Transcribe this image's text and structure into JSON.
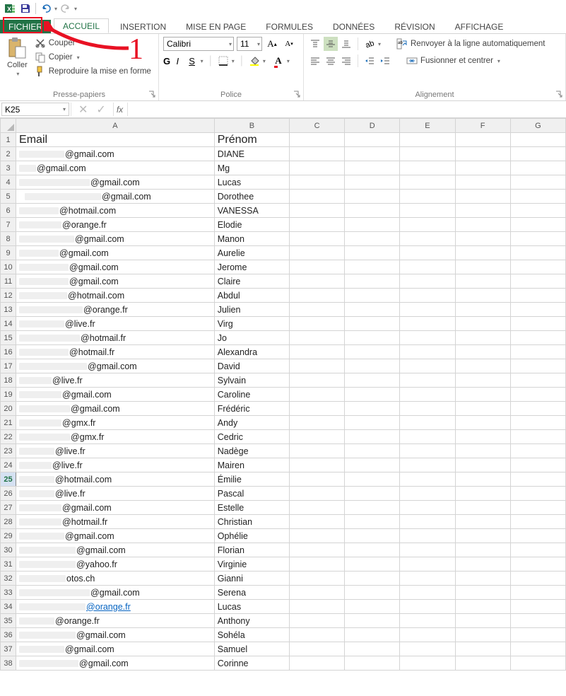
{
  "qat": {
    "save": "Enregistrer",
    "undo": "Annuler",
    "redo": "Rétablir"
  },
  "tabs": {
    "file": "FICHIER",
    "home": "ACCUEIL",
    "insert": "INSERTION",
    "pagelayout": "MISE EN PAGE",
    "formulas": "FORMULES",
    "data": "DONNÉES",
    "review": "RÉVISION",
    "view": "AFFICHAGE"
  },
  "annotation_number": "1",
  "ribbon": {
    "clipboard": {
      "paste": "Coller",
      "cut": "Couper",
      "copy": "Copier",
      "painter": "Reproduire la mise en forme",
      "label": "Presse-papiers"
    },
    "font": {
      "name": "Calibri",
      "size": "11",
      "label": "Police",
      "bold": "G",
      "italic": "I",
      "underline": "S"
    },
    "align": {
      "wrap": "Renvoyer à la ligne automatiquement",
      "merge": "Fusionner et centrer",
      "label": "Alignement"
    }
  },
  "namebox": "K25",
  "fx": "fx",
  "columns": [
    "A",
    "B",
    "C",
    "D",
    "E",
    "F",
    "G"
  ],
  "headers": {
    "a": "Email",
    "b": "Prénom"
  },
  "rows": [
    {
      "n": 2,
      "mask": 64,
      "dom": "@gmail.com",
      "b": "DIANE"
    },
    {
      "n": 3,
      "mask": 24,
      "dom": "@gmail.com",
      "b": "Mg"
    },
    {
      "n": 4,
      "mask": 100,
      "dom": "@gmail.com",
      "b": "Lucas"
    },
    {
      "n": 5,
      "mask": 108,
      "dom": "@gmail.com",
      "b": "Dorothee",
      "off": 8
    },
    {
      "n": 6,
      "mask": 56,
      "dom": "@hotmail.com",
      "b": "VANESSA"
    },
    {
      "n": 7,
      "mask": 60,
      "dom": "@orange.fr",
      "b": "Elodie"
    },
    {
      "n": 8,
      "mask": 78,
      "dom": "@gmail.com",
      "b": "Manon"
    },
    {
      "n": 9,
      "mask": 56,
      "dom": "@gmail.com",
      "b": "Aurelie"
    },
    {
      "n": 10,
      "mask": 70,
      "dom": "@gmail.com",
      "b": "Jerome"
    },
    {
      "n": 11,
      "mask": 70,
      "dom": "@gmail.com",
      "b": "Claire"
    },
    {
      "n": 12,
      "mask": 68,
      "dom": "@hotmail.com",
      "b": "Abdul"
    },
    {
      "n": 13,
      "mask": 90,
      "dom": "@orange.fr",
      "b": "Julien"
    },
    {
      "n": 14,
      "mask": 64,
      "dom": "@live.fr",
      "b": "Virg"
    },
    {
      "n": 15,
      "mask": 86,
      "dom": "@hotmail.fr",
      "b": "Jo"
    },
    {
      "n": 16,
      "mask": 70,
      "dom": "@hotmail.fr",
      "b": "Alexandra"
    },
    {
      "n": 17,
      "mask": 96,
      "dom": "@gmail.com",
      "b": "David"
    },
    {
      "n": 18,
      "mask": 46,
      "dom": "@live.fr",
      "b": "Sylvain"
    },
    {
      "n": 19,
      "mask": 60,
      "dom": "@gmail.com",
      "b": "Caroline"
    },
    {
      "n": 20,
      "mask": 72,
      "dom": "@gmail.com",
      "b": "Frédéric"
    },
    {
      "n": 21,
      "mask": 60,
      "dom": "@gmx.fr",
      "b": "Andy"
    },
    {
      "n": 22,
      "mask": 72,
      "dom": "@gmx.fr",
      "b": "Cedric"
    },
    {
      "n": 23,
      "mask": 50,
      "dom": "@live.fr",
      "b": "Nadège"
    },
    {
      "n": 24,
      "mask": 46,
      "dom": "@live.fr",
      "b": "Mairen"
    },
    {
      "n": 25,
      "mask": 50,
      "dom": "@hotmail.com",
      "b": "Émilie",
      "hl": true
    },
    {
      "n": 26,
      "mask": 50,
      "dom": "@live.fr",
      "b": "Pascal"
    },
    {
      "n": 27,
      "mask": 60,
      "dom": "@gmail.com",
      "b": "Estelle"
    },
    {
      "n": 28,
      "mask": 60,
      "dom": "@hotmail.fr",
      "b": "Christian"
    },
    {
      "n": 29,
      "mask": 64,
      "dom": "@gmail.com",
      "b": "Ophélie"
    },
    {
      "n": 30,
      "mask": 80,
      "dom": "@gmail.com",
      "b": "Florian"
    },
    {
      "n": 31,
      "mask": 80,
      "dom": "@yahoo.fr",
      "b": "Virginie"
    },
    {
      "n": 32,
      "mask": 66,
      "dom": "otos.ch",
      "b": "Gianni"
    },
    {
      "n": 33,
      "mask": 100,
      "dom": "@gmail.com",
      "b": "Serena"
    },
    {
      "n": 34,
      "mask": 94,
      "dom": "@orange.fr",
      "b": "Lucas",
      "link": true
    },
    {
      "n": 35,
      "mask": 50,
      "dom": "@orange.fr",
      "b": "Anthony"
    },
    {
      "n": 36,
      "mask": 80,
      "dom": "@gmail.com",
      "b": "Sohéla"
    },
    {
      "n": 37,
      "mask": 64,
      "dom": "@gmail.com",
      "b": "Samuel"
    },
    {
      "n": 38,
      "mask": 84,
      "dom": "@gmail.com",
      "b": "Corinne"
    }
  ]
}
